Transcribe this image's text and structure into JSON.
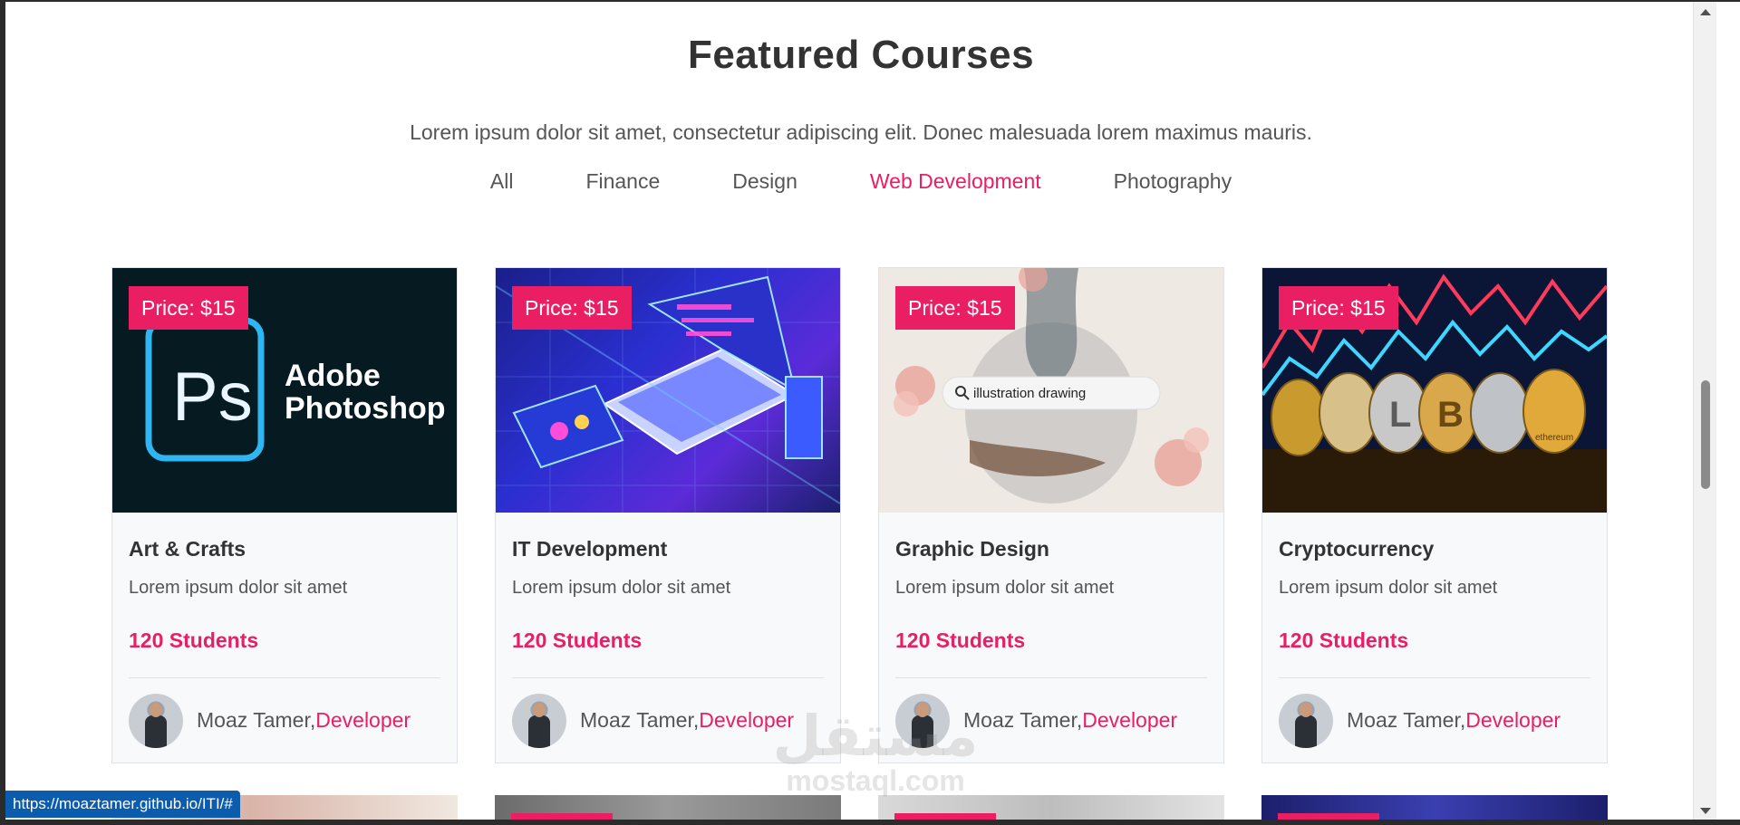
{
  "section": {
    "title": "Featured Courses",
    "subtitle": "Lorem ipsum dolor sit amet, consectetur adipiscing elit. Donec malesuada lorem maximus mauris."
  },
  "filters": [
    {
      "label": "All",
      "active": false
    },
    {
      "label": "Finance",
      "active": false
    },
    {
      "label": "Design",
      "active": false
    },
    {
      "label": "Web Development",
      "active": true
    },
    {
      "label": "Photography",
      "active": false
    }
  ],
  "cards": [
    {
      "price": "Price: $15",
      "title": "Art & Crafts",
      "desc": "Lorem ipsum dolor sit amet",
      "students": "120 Students",
      "author": "Moaz Tamer,",
      "role": "Developer",
      "image": "adobe-photoshop-thumbnail",
      "image_text_1": "Adobe",
      "image_text_2": "Photoshop",
      "image_text_3": "Ps"
    },
    {
      "price": "Price: $15",
      "title": "IT Development",
      "desc": "Lorem ipsum dolor sit amet",
      "students": "120 Students",
      "author": "Moaz Tamer,",
      "role": "Developer",
      "image": "laptop-isometric-thumbnail"
    },
    {
      "price": "Price: $15",
      "title": "Graphic Design",
      "desc": "Lorem ipsum dolor sit amet",
      "students": "120 Students",
      "author": "Moaz Tamer,",
      "role": "Developer",
      "image": "illustration-drawing-thumbnail",
      "search_text": "illustration drawing"
    },
    {
      "price": "Price: $15",
      "title": "Cryptocurrency",
      "desc": "Lorem ipsum dolor sit amet",
      "students": "120 Students",
      "author": "Moaz Tamer,",
      "role": "Developer",
      "image": "crypto-coins-thumbnail",
      "coin_text": "ethereum"
    }
  ],
  "status_url": "https://moaztamer.github.io/ITI/#",
  "watermark": {
    "arabic": "مستقل",
    "latin": "mostaql.com"
  },
  "colors": {
    "accent": "#e91e63",
    "heading": "#333333",
    "text": "#555555",
    "card_bg": "#f8f9fa",
    "status_bar": "#0b5cad"
  }
}
